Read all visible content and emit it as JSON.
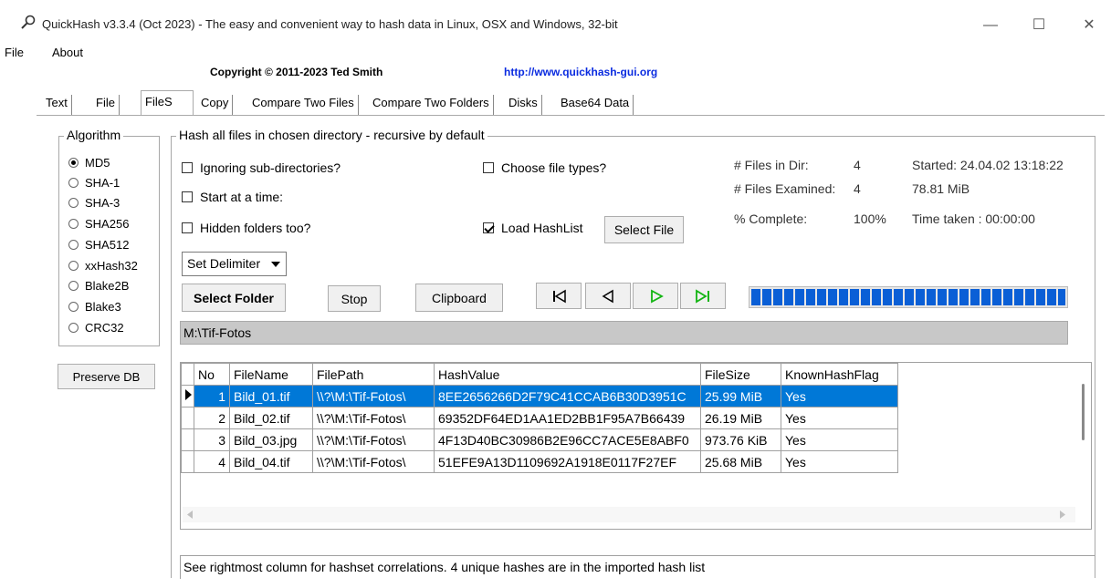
{
  "window": {
    "title": "QuickHash v3.3.4 (Oct 2023) - The easy and convenient way to hash data in Linux, OSX and Windows, 32-bit",
    "controls": {
      "minimize": "—",
      "maximize": "☐",
      "close": "✕"
    }
  },
  "menu": {
    "file": "File",
    "about": "About"
  },
  "header": {
    "copyright": "Copyright © 2011-2023  Ted Smith",
    "url": "http://www.quickhash-gui.org"
  },
  "tabs": [
    "Text",
    "File",
    "FileS",
    "Copy",
    "Compare Two Files",
    "Compare Two Folders",
    "Disks",
    "Base64 Data"
  ],
  "algorithm": {
    "title": "Algorithm",
    "options": [
      "MD5",
      "SHA-1",
      "SHA-3",
      "SHA256",
      "SHA512",
      "xxHash32",
      "Blake2B",
      "Blake3",
      "CRC32"
    ],
    "selected": "MD5"
  },
  "preserve_db": "Preserve DB",
  "hashgroup": {
    "title": "Hash all files in chosen directory - recursive by default",
    "ignore_subdirs": {
      "label": "Ignoring sub-directories?",
      "checked": false
    },
    "start_at_time": {
      "label": "Start at a time:",
      "checked": false
    },
    "hidden_folders": {
      "label": "Hidden folders too?",
      "checked": false
    },
    "choose_types": {
      "label": "Choose file types?",
      "checked": false
    },
    "load_hashlist": {
      "label": "Load HashList",
      "checked": true
    },
    "select_file": "Select File",
    "delimiter": "Set Delimiter",
    "select_folder": "Select Folder",
    "stop": "Stop",
    "clipboard": "Clipboard"
  },
  "stats": {
    "files_in_dir_label": "# Files in Dir:",
    "files_in_dir": "4",
    "files_examined_label": "# Files Examined:",
    "files_examined": "4",
    "complete_label": "% Complete:",
    "complete": "100%",
    "started": "Started: 24.04.02 13:18:22",
    "size": "78.81 MiB",
    "time_taken": "Time taken : 00:00:00",
    "progress_fraction": 1.0
  },
  "path": "M:\\Tif-Fotos",
  "grid": {
    "columns": [
      "No",
      "FileName",
      "FilePath",
      "HashValue",
      "FileSize",
      "KnownHashFlag"
    ],
    "rows": [
      [
        "1",
        "Bild_01.tif",
        "\\\\?\\M:\\Tif-Fotos\\",
        "8EE2656266D2F79C41CCAB6B30D3951C",
        "25.99 MiB",
        "Yes"
      ],
      [
        "2",
        "Bild_02.tif",
        "\\\\?\\M:\\Tif-Fotos\\",
        "69352DF64ED1AA1ED2BB1F95A7B66439",
        "26.19 MiB",
        "Yes"
      ],
      [
        "3",
        "Bild_03.jpg",
        "\\\\?\\M:\\Tif-Fotos\\",
        "4F13D40BC30986B2E96CC7ACE5E8ABF0",
        "973.76 KiB",
        "Yes"
      ],
      [
        "4",
        "Bild_04.tif",
        "\\\\?\\M:\\Tif-Fotos\\",
        "51EFE9A13D1109692A1918E0117F27EF",
        "25.68 MiB",
        "Yes"
      ]
    ],
    "selected_row": 0
  },
  "status": "See rightmost column for hashset correlations. 4 unique hashes are in the imported hash list",
  "colors": {
    "accent": "#0078d7",
    "progress": "#0a5fd6",
    "green_nav": "#13b513"
  }
}
